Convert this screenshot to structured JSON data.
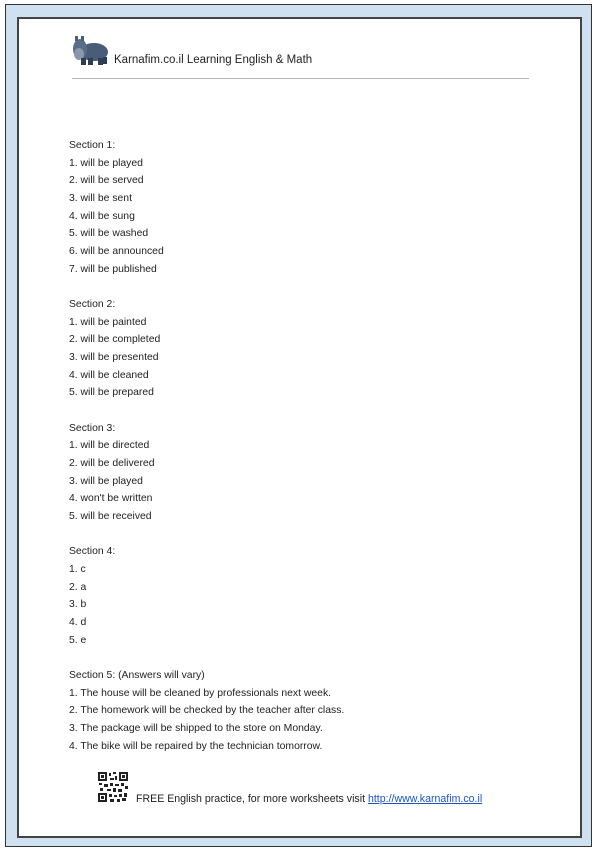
{
  "header": {
    "logo_icon": "hippo-icon",
    "title": "Karnafim.co.il Learning English & Math"
  },
  "sections": [
    {
      "title": "Section 1:",
      "items": [
        "1. will be played",
        "2. will be served",
        "3. will be sent",
        "4. will be sung",
        "5. will be washed",
        "6. will be announced",
        "7. will be published"
      ]
    },
    {
      "title": "Section 2:",
      "items": [
        "1. will be painted",
        "2. will be completed",
        "3. will be presented",
        "4. will be cleaned",
        "5. will be prepared"
      ]
    },
    {
      "title": "Section 3:",
      "items": [
        "1. will be directed",
        "2. will be delivered",
        "3. will be played",
        "4. won't be written",
        "5. will be received"
      ]
    },
    {
      "title": "Section 4:",
      "items": [
        "1. c",
        "2. a",
        "3. b",
        "4. d",
        "5. e"
      ]
    },
    {
      "title": "Section 5: (Answers will vary)",
      "items": [
        "1. The house will be cleaned by professionals next week.",
        "2. The homework will be checked by the teacher after class.",
        "3. The package will be shipped to the store on Monday.",
        "4. The bike will be repaired by the technician tomorrow."
      ]
    }
  ],
  "footer": {
    "qr_icon": "qr-code-icon",
    "text": "FREE English practice, for more worksheets visit ",
    "link_text": "http://www.karnafim.co.il"
  },
  "colors": {
    "frame_background": "#cfe1f1",
    "link": "#1a55c9"
  }
}
